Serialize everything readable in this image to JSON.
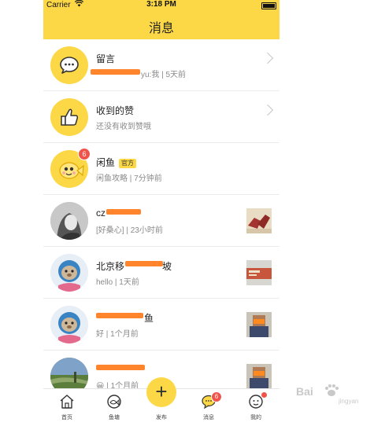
{
  "status_bar": {
    "carrier": "Carrier",
    "time": "3:18 PM"
  },
  "header": {
    "title": "消息"
  },
  "messages": [
    {
      "name": "留言",
      "subtitle": "yu:我 | 5天前",
      "avatar_icon": "chat-bubble-icon"
    },
    {
      "name": "收到的赞",
      "subtitle": "还没有收到赞哦",
      "avatar_icon": "thumbs-up-icon"
    },
    {
      "name": "闲鱼",
      "tag": "官方",
      "subtitle": "闲鱼攻略 | 7分钟前",
      "badge": "6",
      "avatar_icon": "fish-mascot-icon"
    },
    {
      "name": "cz",
      "subtitle": "[好桑心] | 23小时前"
    },
    {
      "name": "北京移",
      "name_suffix": "坡",
      "subtitle": "hello | 1天前"
    },
    {
      "name": "鱼",
      "subtitle": "好 | 1个月前"
    },
    {
      "name": "",
      "subtitle": "| 1个月前",
      "subtitle_emoji": "😀"
    }
  ],
  "tabbar": {
    "items": [
      {
        "label": "首页",
        "icon": "home-icon"
      },
      {
        "label": "鱼塘",
        "icon": "fish-pond-icon"
      },
      {
        "label": "发布",
        "icon": "plus-icon"
      },
      {
        "label": "消息",
        "icon": "message-icon",
        "badge": "6"
      },
      {
        "label": "我的",
        "icon": "profile-icon"
      }
    ],
    "plus_symbol": "+"
  },
  "watermark": {
    "text": "Bai",
    "sub": "jingyan"
  },
  "colors": {
    "accent": "#FCD846",
    "badge": "#f0534a",
    "redaction": "#FF7A1A"
  }
}
